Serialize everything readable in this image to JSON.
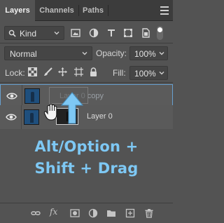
{
  "tabs": [
    {
      "label": "Layers",
      "active": true
    },
    {
      "label": "Channels",
      "active": false
    },
    {
      "label": "Paths",
      "active": false
    }
  ],
  "filter": {
    "kind_label": "Kind",
    "icons": [
      "pixel-filter-icon",
      "adjustment-filter-icon",
      "type-filter-icon",
      "shape-filter-icon",
      "smart-object-filter-icon"
    ]
  },
  "blend": {
    "mode": "Normal",
    "opacity_label": "Opacity:",
    "opacity_value": "100%"
  },
  "lock": {
    "label": "Lock:",
    "fill_label": "Fill:",
    "fill_value": "100%"
  },
  "layers": [
    {
      "name": "Layer 0 copy",
      "selected": true
    },
    {
      "name": "Layer 0",
      "selected": false
    }
  ],
  "caption": {
    "line1": "Alt/Option +",
    "line2": "Shift + Drag"
  },
  "colors": {
    "panel_bg": "#535353",
    "caption": "#7ec8f4",
    "arrow": "#7ec8f4",
    "selection_border": "#68a0cf"
  }
}
